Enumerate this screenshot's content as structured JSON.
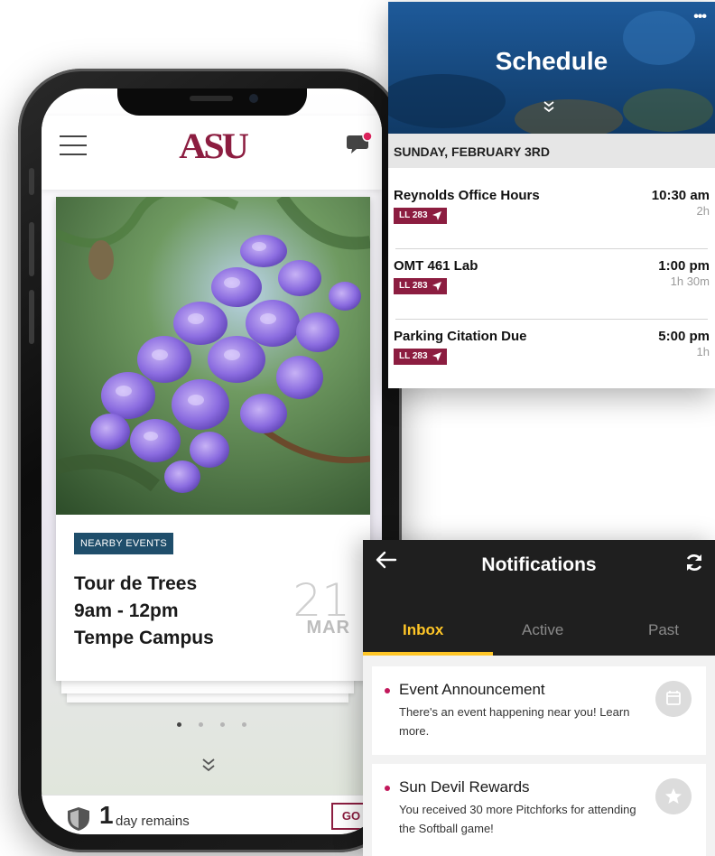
{
  "header": {
    "logo": "ASU"
  },
  "event": {
    "badge": "NEARBY EVENTS",
    "title_lines": [
      "Tour de Trees",
      "9am - 12pm",
      "Tempe Campus"
    ],
    "day": "21",
    "month": "MAR"
  },
  "pager": {
    "total": 4,
    "active": 0
  },
  "reminder": {
    "count": "1",
    "text": "day remains",
    "go_label": "GO"
  },
  "schedule": {
    "title": "Schedule",
    "date": "SUNDAY, FEBRUARY 3RD",
    "items": [
      {
        "title": "Reynolds Office Hours",
        "location": "LL 283",
        "time": "10:30 am",
        "duration": "2h"
      },
      {
        "title": "OMT 461 Lab",
        "location": "LL 283",
        "time": "1:00 pm",
        "duration": "1h 30m"
      },
      {
        "title": "Parking Citation Due",
        "location": "LL 283",
        "time": "5:00 pm",
        "duration": "1h"
      }
    ]
  },
  "notifications": {
    "title": "Notifications",
    "tabs": [
      {
        "label": "Inbox",
        "active": true
      },
      {
        "label": "Active",
        "active": false
      },
      {
        "label": "Past",
        "active": false
      }
    ],
    "items": [
      {
        "title": "Event Announcement",
        "body": "There's an event happening near you! Learn more.",
        "icon": "calendar-icon"
      },
      {
        "title": "Sun Devil Rewards",
        "body": "You received 30 more Pitchforks for attending the Softball game!",
        "icon": "star-icon"
      }
    ]
  },
  "colors": {
    "asu_maroon": "#8c1d40",
    "asu_gold": "#ffc627",
    "badge_blue": "#1f4e6b",
    "notification_dot": "#c2185b"
  }
}
